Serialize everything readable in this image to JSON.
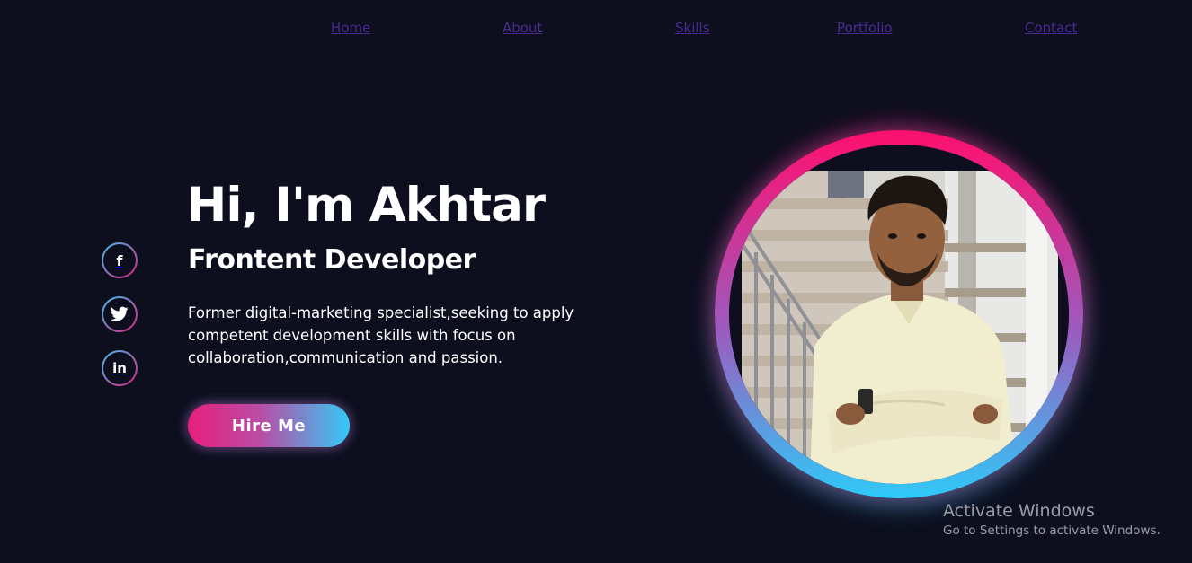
{
  "nav": {
    "items": [
      {
        "label": "Home"
      },
      {
        "label": "About"
      },
      {
        "label": "Skills"
      },
      {
        "label": "Portfolio"
      },
      {
        "label": "Contact"
      }
    ]
  },
  "social": [
    {
      "icon": "facebook-icon",
      "glyph": "f"
    },
    {
      "icon": "twitter-icon"
    },
    {
      "icon": "linkedin-icon",
      "glyph": "in"
    }
  ],
  "hero": {
    "title": "Hi, I'm Akhtar",
    "subtitle": "Frontent Developer",
    "description": "Former digital-marketing specialist,seeking to apply competent development skills with focus on collaboration,communication and passion.",
    "button_label": "Hire Me"
  },
  "colors": {
    "background": "#0d0f1f",
    "accent_pink": "#e71f7c",
    "accent_blue": "#35c9f7",
    "nav_link": "#4a2a8f"
  },
  "watermark": {
    "title": "Activate Windows",
    "subtitle": "Go to Settings to activate Windows."
  }
}
